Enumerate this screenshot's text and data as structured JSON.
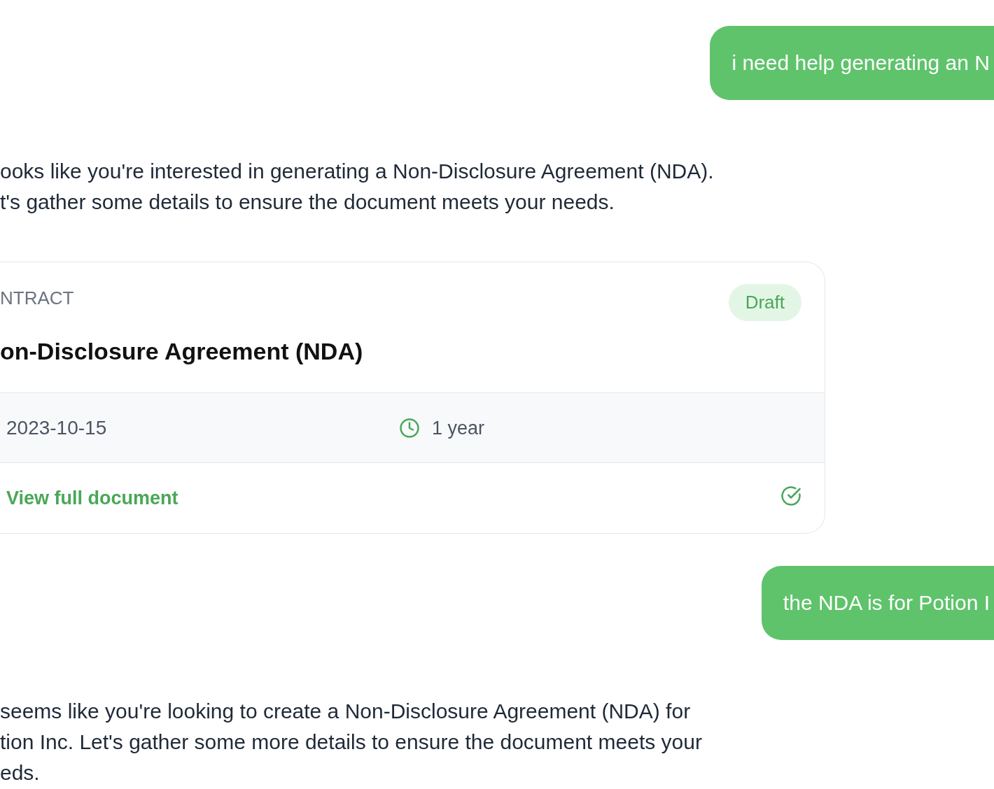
{
  "messages": [
    {
      "kind": "user",
      "text": "i need help generating an N"
    },
    {
      "kind": "assistant",
      "lines": [
        "ooks like you're interested in generating a Non-Disclosure Agreement (NDA).",
        "t's gather some details to ensure the document meets your needs."
      ]
    },
    {
      "kind": "contract_card",
      "category": "NTRACT",
      "status": "Draft",
      "title": "on-Disclosure Agreement (NDA)",
      "date": "2023-10-15",
      "duration": "1 year",
      "link": "View full document"
    },
    {
      "kind": "user",
      "text": "the NDA is for Potion I"
    },
    {
      "kind": "assistant",
      "lines": [
        "seems like you're looking to create a Non-Disclosure Agreement (NDA) for",
        "tion Inc. Let's gather some more details to ensure the document meets your",
        "eds."
      ]
    }
  ]
}
